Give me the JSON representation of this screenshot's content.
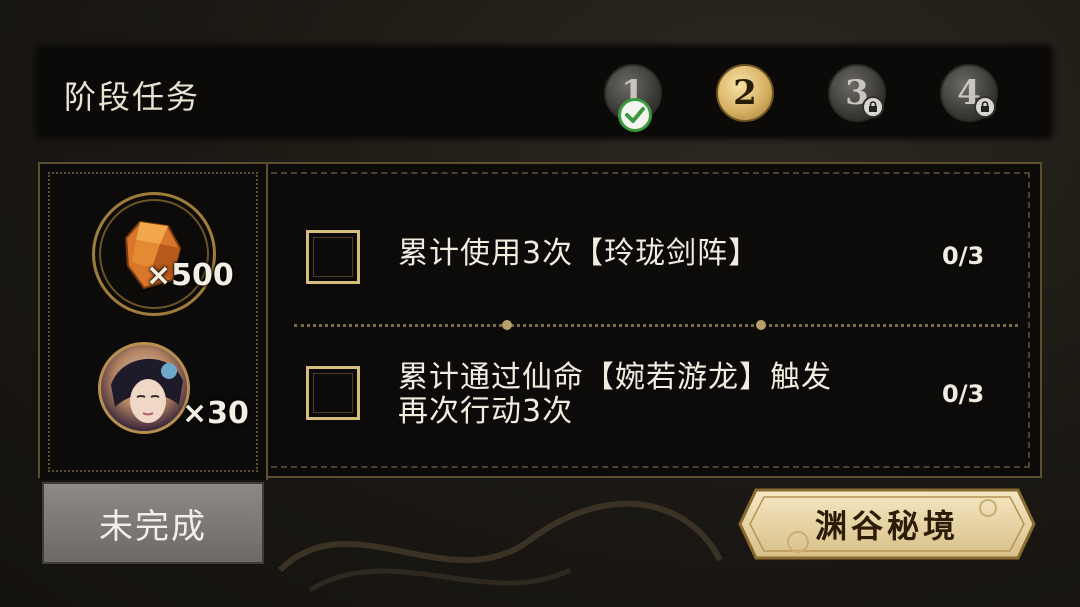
{
  "header": {
    "title": "阶段任务",
    "stages": [
      {
        "label": "1",
        "state": "completed"
      },
      {
        "label": "2",
        "state": "current"
      },
      {
        "label": "3",
        "state": "locked"
      },
      {
        "label": "4",
        "state": "locked"
      }
    ]
  },
  "rewards": [
    {
      "icon": "amber-crystal-icon",
      "quantity": "×500"
    },
    {
      "icon": "character-portrait-icon",
      "quantity": "×30"
    }
  ],
  "tasks": [
    {
      "text": "累计使用3次【玲珑剑阵】",
      "progress": "0/3",
      "checked": false
    },
    {
      "text_line1": "累计通过仙命【婉若游龙】触发",
      "text_line2": "再次行动3次",
      "progress": "0/3",
      "checked": false
    }
  ],
  "status": {
    "label": "未完成"
  },
  "action_button": {
    "label": "渊谷秘境"
  },
  "colors": {
    "gold": "#d6bd7c",
    "panel_bg": "#0c0b09",
    "completed_green": "#3c9a3e",
    "status_gray": "#7d7a76"
  }
}
